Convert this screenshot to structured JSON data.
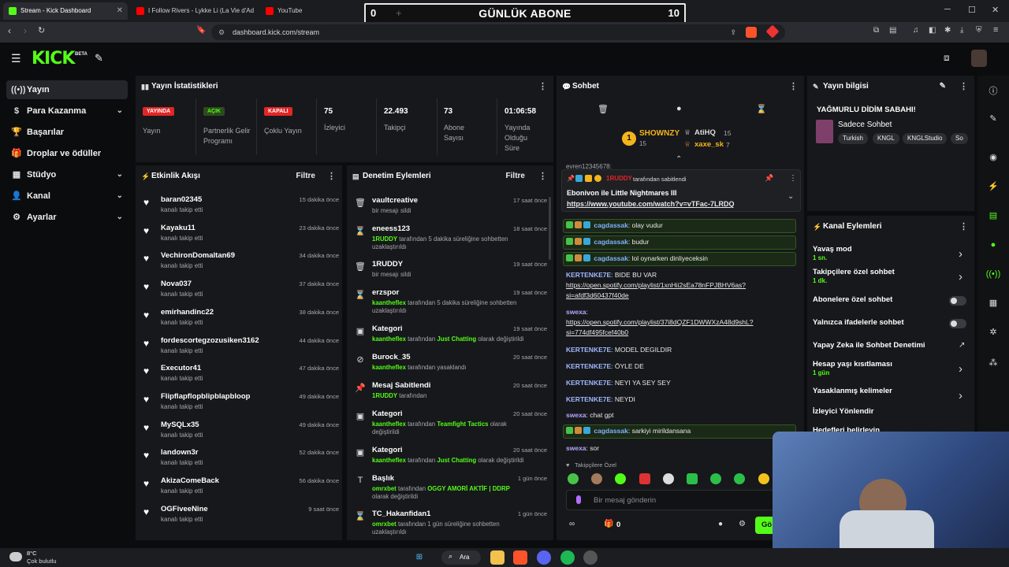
{
  "browser": {
    "tabs": [
      {
        "title": "Stream - Kick Dashboard",
        "favicon_color": "#53fc18"
      },
      {
        "title": "I Follow Rivers - Lykke Li (La Vie d'Ad",
        "favicon_color": "#ff0000"
      },
      {
        "title": "YouTube",
        "favicon_color": "#ff0000"
      }
    ],
    "url": "dashboard.kick.com/stream"
  },
  "overlay": {
    "left": "0",
    "title": "GÜNLÜK ABONE",
    "right": "10"
  },
  "brand": {
    "logo": "KICK",
    "beta": "BETA",
    "accent": "#53fc18"
  },
  "sidebar": {
    "items": [
      {
        "label": "Yayın",
        "icon": "broadcast-icon"
      },
      {
        "label": "Para Kazanma",
        "icon": "dollar-icon"
      },
      {
        "label": "Başarılar",
        "icon": "trophy-icon"
      },
      {
        "label": "Droplar ve ödüller",
        "icon": "gift-icon"
      },
      {
        "label": "Stüdyo",
        "icon": "grid-icon"
      },
      {
        "label": "Kanal",
        "icon": "user-icon"
      },
      {
        "label": "Ayarlar",
        "icon": "gear-icon"
      }
    ]
  },
  "stats": {
    "title": "Yayın İstatistikleri",
    "items": [
      {
        "pill": "YAYINDA",
        "label": "Yayın"
      },
      {
        "pill": "AÇIK",
        "label": "Partnerlik Gelir Programı"
      },
      {
        "pill": "KAPALI",
        "label": "Çoklu Yayın"
      },
      {
        "value": "75",
        "label": "İzleyici"
      },
      {
        "value": "22.493",
        "label": "Takipçi"
      },
      {
        "value": "73",
        "label": "Abone Sayısı"
      },
      {
        "value": "01:06:58",
        "label": "Yayında Olduğu Süre"
      }
    ]
  },
  "activity": {
    "title": "Etkinlik Akışı",
    "filter": "Filtre",
    "items": [
      {
        "name": "baran02345",
        "sub": "kanalı takip etti",
        "time": "15 dakika önce"
      },
      {
        "name": "Kayaku11",
        "sub": "kanalı takip etti",
        "time": "23 dakika önce"
      },
      {
        "name": "VechironDomaltan69",
        "sub": "kanalı takip etti",
        "time": "34 dakika önce"
      },
      {
        "name": "Nova037",
        "sub": "kanalı takip etti",
        "time": "37 dakika önce"
      },
      {
        "name": "emirhandinc22",
        "sub": "kanalı takip etti",
        "time": "38 dakika önce"
      },
      {
        "name": "fordescortegzozusiken3162",
        "sub": "kanalı takip etti",
        "time": "44 dakika önce"
      },
      {
        "name": "Executor41",
        "sub": "kanalı takip etti",
        "time": "47 dakika önce"
      },
      {
        "name": "Flipflapflopblipblapbloop",
        "sub": "kanalı takip etti",
        "time": "49 dakika önce"
      },
      {
        "name": "MySQLx35",
        "sub": "kanalı takip etti",
        "time": "49 dakika önce"
      },
      {
        "name": "landown3r",
        "sub": "kanalı takip etti",
        "time": "52 dakika önce"
      },
      {
        "name": "AkizaComeBack",
        "sub": "kanalı takip etti",
        "time": "56 dakika önce"
      },
      {
        "name": "OGFiveeNine",
        "sub": "kanalı takip etti",
        "time": "9 saat önce"
      }
    ]
  },
  "moderation": {
    "title": "Denetim Eylemleri",
    "filter": "Filtre",
    "items": [
      {
        "icon": "trash-icon",
        "glyph": "🗑",
        "name": "vaultcreative",
        "actor": "",
        "text": "bir mesajı sildi",
        "extra": "",
        "tail": "",
        "time": "17 saat önce"
      },
      {
        "icon": "hourglass-icon",
        "glyph": "⌛",
        "name": "eneess123",
        "actor": "1RUDDY",
        "text": "tarafından 5 dakika süreliğine sohbetten uzaklaştırıldı",
        "extra": "",
        "tail": "",
        "time": "18 saat önce"
      },
      {
        "icon": "trash-icon",
        "glyph": "🗑",
        "name": "1RUDDY",
        "actor": "",
        "text": "bir mesajı sildi",
        "extra": "",
        "tail": "",
        "time": "19 saat önce"
      },
      {
        "icon": "hourglass-icon",
        "glyph": "⌛",
        "name": "erzspor",
        "actor": "kaantheflex",
        "text": "tarafından 5 dakika süreliğine sohbetten uzaklaştırıldı",
        "extra": "",
        "tail": "",
        "time": "19 saat önce"
      },
      {
        "icon": "category-icon",
        "glyph": "▣",
        "name": "Kategori",
        "actor": "kaantheflex",
        "text": "tarafından",
        "extra": "Just Chatting",
        "tail": "olarak değiştirildi",
        "time": "19 saat önce"
      },
      {
        "icon": "ban-icon",
        "glyph": "⊘",
        "name": "Burock_35",
        "actor": "kaantheflex",
        "text": "tarafından yasaklandı",
        "extra": "",
        "tail": "",
        "time": "20 saat önce"
      },
      {
        "icon": "pin-icon",
        "glyph": "📌",
        "name": "Mesaj Sabitlendi",
        "actor": "1RUDDY",
        "text": "tarafından",
        "extra": "",
        "tail": "",
        "time": "20 saat önce"
      },
      {
        "icon": "category-icon",
        "glyph": "▣",
        "name": "Kategori",
        "actor": "kaantheflex",
        "text": "tarafından",
        "extra": "Teamfight Tactics",
        "tail": "olarak değiştirildi",
        "time": "20 saat önce"
      },
      {
        "icon": "category-icon",
        "glyph": "▣",
        "name": "Kategori",
        "actor": "kaantheflex",
        "text": "tarafından",
        "extra": "Just Chatting",
        "tail": "olarak değiştirildi",
        "time": "20 saat önce"
      },
      {
        "icon": "title-icon",
        "glyph": "T",
        "name": "Başlık",
        "actor": "omrxbet",
        "text": "tarafından",
        "extra": "OGGY AMORİ AKTİF | DDRP",
        "tail": "olarak değiştirildi",
        "time": "1 gün önce"
      },
      {
        "icon": "hourglass-icon",
        "glyph": "⌛",
        "name": "TC_Hakanfidan1",
        "actor": "omrxbet",
        "text": "tarafından 1 gün süreliğine sohbetten uzaklaştırıldı",
        "extra": "",
        "tail": "",
        "time": "1 gün önce"
      }
    ]
  },
  "chat": {
    "title": "Sohbet",
    "top_gifter": {
      "name": "SHOWNZY",
      "count": "15",
      "rank": "1"
    },
    "gifters": [
      {
        "name": "AtiHQ",
        "count": "15"
      },
      {
        "name": "xaxe_sk",
        "count": "7"
      }
    ],
    "cut_user": "evren12345678:",
    "pinned": {
      "by": "1RUDDY",
      "by_suffix": "tarafından sabitlendi",
      "text": "Ebonivon ile Little Nightmares III",
      "link": "https://www.youtube.com/watch?v=vTFac-7LRDQ"
    },
    "messages": [
      {
        "user": "cagdassak",
        "color": "#7fb2ff",
        "text": "olay vudur",
        "highlight": true
      },
      {
        "user": "cagdassak",
        "color": "#7fb2ff",
        "text": "budur",
        "highlight": true
      },
      {
        "user": "cagdassak",
        "color": "#7fb2ff",
        "text": "lol oynarken dinliyeceksin",
        "highlight": true
      },
      {
        "user": "KERTENKE7E",
        "color": "#9fb8ff",
        "text": "BIDE BU VAR",
        "link": "https://open.spotify.com/playlist/1xnHii2sEa78nFPJBHV6as?si=afdf3d60437f40de"
      },
      {
        "user": "swexa",
        "color": "#b9a4ff",
        "text": "",
        "link": "https://open.spotify.com/playlist/37i8dQZF1DWWXzA48d9shL?si=774df495fcef40b0"
      },
      {
        "user": "KERTENKE7E",
        "color": "#9fb8ff",
        "text": "MODEL DEGILDIR"
      },
      {
        "user": "KERTENKE7E",
        "color": "#9fb8ff",
        "text": "ÖYLE DE"
      },
      {
        "user": "KERTENKE7E",
        "color": "#9fb8ff",
        "text": "NEYI YA SEY SEY"
      },
      {
        "user": "KERTENKE7E",
        "color": "#9fb8ff",
        "text": "NEYDI"
      },
      {
        "user": "swexa",
        "color": "#b9a4ff",
        "text": "chat gpt"
      },
      {
        "user": "cagdassak",
        "color": "#7fb2ff",
        "text": "sarkiyi mirildansana",
        "highlight": true
      },
      {
        "user": "swexa",
        "color": "#b9a4ff",
        "text": "sor"
      }
    ],
    "mode": "Takipçilere Özel",
    "input_placeholder": "Bir mesaj gönderin",
    "points": "0",
    "send_label": "Gö"
  },
  "stream_info": {
    "title": "Yayın bilgisi",
    "stream_title": "YAĞMURLU DİDİM SABAHI!",
    "category": "Sadece Sohbet",
    "tags": [
      "Turkish",
      "KNGL",
      "KNGLStudio",
      "So"
    ]
  },
  "channel_actions": {
    "title": "Kanal Eylemleri",
    "items": [
      {
        "label": "Yavaş mod",
        "sub": "1 sn.",
        "control": "chevron"
      },
      {
        "label": "Takipçilere özel sohbet",
        "sub": "1 dk.",
        "control": "chevron"
      },
      {
        "label": "Abonelere özel sohbet",
        "sub": "",
        "control": "toggle"
      },
      {
        "label": "Yalnızca ifadelerle sohbet",
        "sub": "",
        "control": "toggle"
      },
      {
        "label": "Yapay Zeka ile Sohbet Denetimi",
        "sub": "",
        "control": "external"
      },
      {
        "label": "Hesap yaşı kısıtlaması",
        "sub": "1 gün",
        "control": "chevron"
      },
      {
        "label": "Yasaklanmış kelimeler",
        "sub": "",
        "control": "chevron"
      },
      {
        "label": "İzleyici Yönlendir",
        "sub": "",
        "control": "none"
      },
      {
        "label": "Hedefleri belirleyin",
        "sub": "",
        "control": "chevron"
      }
    ]
  },
  "taskbar": {
    "weather_temp": "8°C",
    "weather_desc": "Çok bulutlu",
    "search": "Ara"
  }
}
